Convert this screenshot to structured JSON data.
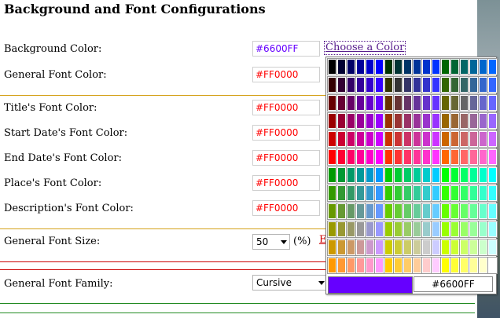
{
  "title": "Background and Font Configurations",
  "rows": [
    {
      "label": "Background Color:",
      "value": "#6600FF"
    },
    {
      "label": "General Font Color:",
      "value": "#FF0000"
    },
    {
      "label": "Title's Font Color:",
      "value": "#FF0000"
    },
    {
      "label": "Start Date's Font Color:",
      "value": "#FF0000"
    },
    {
      "label": "End Date's Font Color:",
      "value": "#FF0000"
    },
    {
      "label": "Place's Font Color:",
      "value": "#FF0000"
    },
    {
      "label": "Description's Font Color:",
      "value": "#FF0000"
    }
  ],
  "choose_color_link": "Choose a Color",
  "font_size": {
    "label": "General Font Size:",
    "value": "50",
    "unit": "(%)",
    "trailing_link": "E"
  },
  "font_family": {
    "label": "General Font Family:",
    "value": "Cursive"
  },
  "picker": {
    "selected_hex": "#6600FF",
    "selected_color": "#6600ff"
  },
  "colors": {
    "separator_gold": "#d4a017",
    "separator_red": "#cc0000",
    "separator_green": "#228b22"
  }
}
